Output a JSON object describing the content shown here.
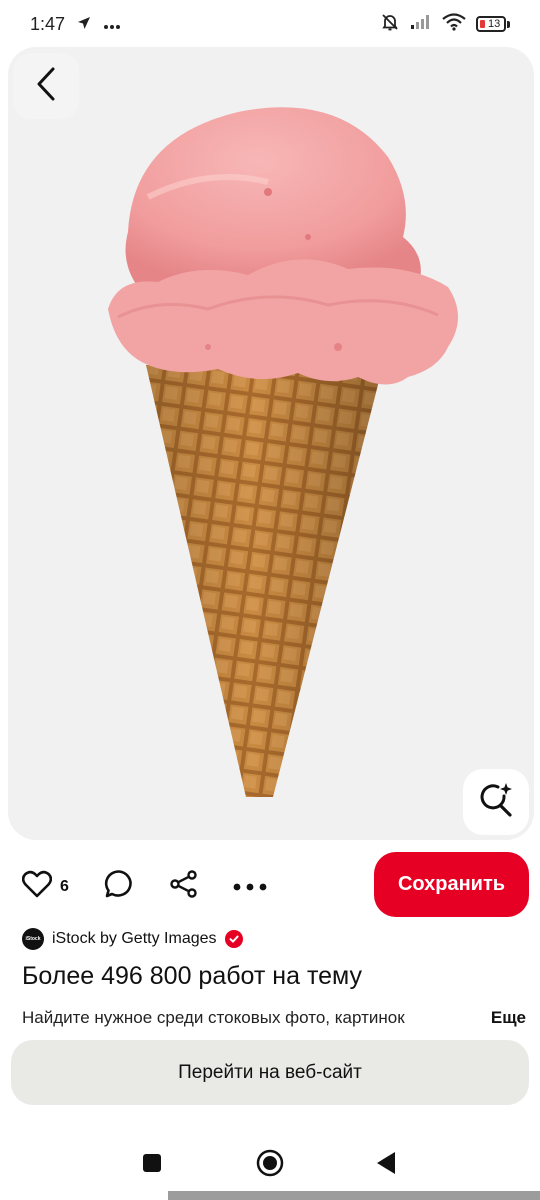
{
  "status_bar": {
    "time": "1:47",
    "battery_level": "13",
    "icons": [
      "navigation-arrow-icon",
      "more-dots-icon",
      "muted-bell-icon",
      "signal-icon",
      "wifi-icon",
      "battery-icon"
    ]
  },
  "image": {
    "subject": "strawberry ice cream cone",
    "background_color": "#f1f1f1",
    "scoop_color": "#f3a1a3",
    "cone_color": "#c9893e"
  },
  "actions": {
    "like_count": "6",
    "save_label": "Сохранить",
    "icons": [
      "heart-icon",
      "comment-icon",
      "share-icon",
      "more-horizontal-icon"
    ]
  },
  "source": {
    "avatar_text": "iStock",
    "name": "iStock by Getty Images",
    "verified": true
  },
  "pin": {
    "title": "Более 496 800 работ на тему",
    "description": "Найдите нужное среди  стоковых фото, картинок",
    "more_label": "Еще"
  },
  "visit_button_label": "Перейти на веб-сайт",
  "colors": {
    "accent": "#e60023",
    "secondary_button": "#e9e9e6"
  }
}
